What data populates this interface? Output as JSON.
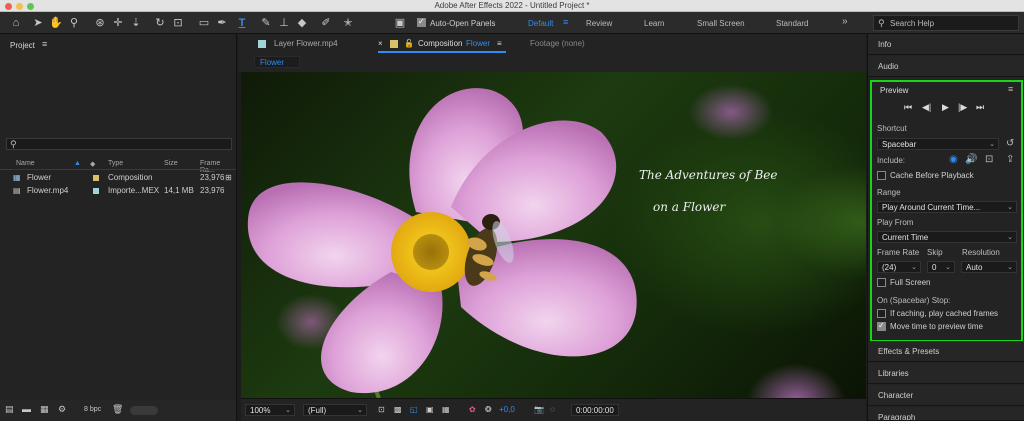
{
  "window": {
    "title": "Adobe After Effects 2022 - Untitled Project *"
  },
  "toolbar": {
    "auto_open_label": "Auto-Open Panels",
    "workspaces": [
      "Default",
      "Review",
      "Learn",
      "Small Screen",
      "Standard"
    ],
    "search_placeholder": "Search Help"
  },
  "project": {
    "title": "Project",
    "columns": {
      "name": "Name",
      "type": "Type",
      "size": "Size",
      "frame_rate": "Frame Ra..."
    },
    "items": [
      {
        "name": "Flower",
        "type": "Composition",
        "size": "",
        "frame_rate": "23,976",
        "color": "#d9c16a"
      },
      {
        "name": "Flower.mp4",
        "type": "Importe...MEX",
        "size": "14,1 MB",
        "frame_rate": "23,976",
        "color": "#9fd3d8"
      }
    ],
    "bpc": "8 bpc"
  },
  "viewer": {
    "tabs": {
      "layer": "Layer Flower.mp4",
      "composition_prefix": "Composition",
      "composition_name": "Flower",
      "footage": "Footage (none)"
    },
    "comp_chip": "Flower",
    "overlay_line1": "The Adventures of Bee",
    "overlay_line2": "on a Flower",
    "zoom": "100%",
    "resolution": "(Full)",
    "exposure": "+0,0",
    "timecode": "0:00:00:00"
  },
  "right": {
    "info": "Info",
    "audio": "Audio",
    "preview": {
      "title": "Preview",
      "shortcut_label": "Shortcut",
      "shortcut_value": "Spacebar",
      "include_label": "Include:",
      "cache_before": "Cache Before Playback",
      "range_label": "Range",
      "range_value": "Play Around Current Time...",
      "play_from_label": "Play From",
      "play_from_value": "Current Time",
      "frame_rate_label": "Frame Rate",
      "skip_label": "Skip",
      "resolution_label": "Resolution",
      "frame_rate_value": "(24)",
      "skip_value": "0",
      "resolution_value": "Auto",
      "full_screen": "Full Screen",
      "stop_label": "On (Spacebar) Stop:",
      "if_caching": "If caching, play cached frames",
      "move_time": "Move time to preview time"
    },
    "effects": "Effects & Presets",
    "libraries": "Libraries",
    "character": "Character",
    "paragraph": "Paragraph"
  },
  "colors": {
    "accent": "#2f8cf4",
    "highlight_box": "#19d419"
  }
}
